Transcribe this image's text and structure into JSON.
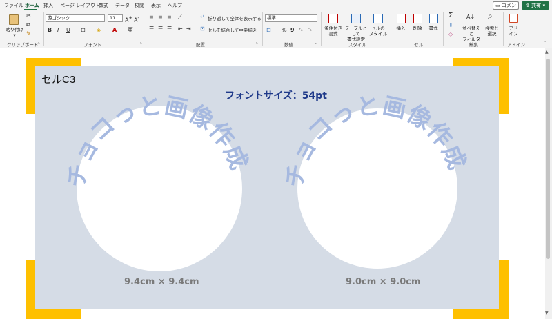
{
  "menu": {
    "items": [
      "ファイル",
      "ホーム",
      "挿入",
      "ページ レイアウト",
      "数式",
      "データ",
      "校閲",
      "表示",
      "ヘルプ"
    ],
    "comment_label": "コメント",
    "share_label": "共有"
  },
  "ribbon": {
    "clipboard": {
      "paste_label": "貼り付け",
      "group_label": "クリップボード"
    },
    "font": {
      "font_name": "游ゴシック",
      "font_size": "11",
      "group_label": "フォント"
    },
    "alignment": {
      "wrap_label": "折り返して全体を表示する",
      "merge_label": "セルを結合して中央揃え",
      "group_label": "配置"
    },
    "number": {
      "format": "標準",
      "group_label": "数値"
    },
    "styles": {
      "conditional_label_1": "条件付き",
      "conditional_label_2": "書式",
      "table_label_1": "テーブルとして",
      "table_label_2": "書式設定",
      "cellstyle_label_1": "セルの",
      "cellstyle_label_2": "スタイル",
      "group_label": "スタイル"
    },
    "cells": {
      "insert_label": "挿入",
      "delete_label": "削除",
      "format_label": "書式",
      "group_label": "セル"
    },
    "editing": {
      "sort_label_1": "並べ替えと",
      "sort_label_2": "フィルター",
      "find_label_1": "検索と",
      "find_label_2": "選択",
      "group_label": "編集"
    },
    "addins": {
      "label_1": "アド",
      "label_2": "イン",
      "group_label": "アドイン"
    }
  },
  "sheet": {
    "cell_label": "セルC3",
    "font_size_title": "フォントサイズ：54pt",
    "arc_text": "チョコっと画像作成",
    "captions": [
      "9.4cm × 9.4cm",
      "9.0cm × 9.0cm"
    ]
  },
  "colors": {
    "accent": "#217346",
    "panel": "#d5dce6",
    "arc_text": "#a6b9e0",
    "corner": "#fec000",
    "title": "#1f3a8a"
  }
}
